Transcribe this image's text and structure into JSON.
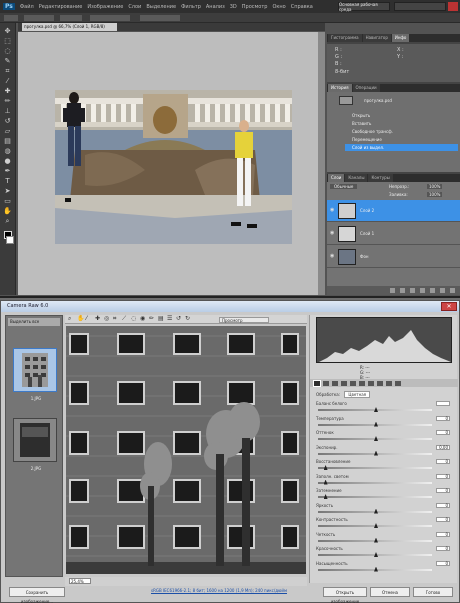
{
  "photoshop": {
    "logo": "Ps",
    "menu": [
      "Файл",
      "Редактирование",
      "Изображение",
      "Слои",
      "Выделение",
      "Фильтр",
      "Анализ",
      "3D",
      "Просмотр",
      "Окно",
      "Справка"
    ],
    "workspace": "Основная рабочая среда",
    "search_placeholder": "",
    "document_tab": "прогулка.psd @ 66,7% (Слой 1, RGB/8)",
    "tools": [
      "move-icon",
      "marquee-icon",
      "lasso-icon",
      "quick-select-icon",
      "crop-icon",
      "eyedropper-icon",
      "healing-icon",
      "brush-icon",
      "stamp-icon",
      "history-brush-icon",
      "eraser-icon",
      "gradient-icon",
      "blur-icon",
      "dodge-icon",
      "pen-icon",
      "type-icon",
      "path-select-icon",
      "shape-icon",
      "hand-icon",
      "zoom-icon"
    ],
    "info_panel": {
      "tabs": [
        "Гистограмма",
        "Навигатор",
        "Инфо"
      ],
      "rows": [
        "R :",
        "G :",
        "B :",
        "8-бит",
        "X :",
        "Y :"
      ]
    },
    "history_panel": {
      "tabs": [
        "История",
        "Операции"
      ],
      "document": "прогулка.psd",
      "states": [
        "Открыть",
        "Вставить",
        "Свободное трансф.",
        "Перемещение",
        "Слой из выдел."
      ]
    },
    "layers_panel": {
      "tabs": [
        "Слои",
        "Каналы",
        "Контуры"
      ],
      "blend_mode": "Обычные",
      "opacity_label": "Непрозр.:",
      "opacity": "100%",
      "fill_label": "Заливка:",
      "fill": "100%",
      "layers": [
        {
          "name": "Слой 2",
          "selected": true
        },
        {
          "name": "Слой 1",
          "selected": false
        },
        {
          "name": "Фон",
          "selected": false
        }
      ]
    },
    "colors": {
      "accent": "#3d91e6",
      "canvas_bg": "#bdbdbd",
      "panel_bg": "#535353"
    }
  },
  "camera_raw": {
    "title": "Camera Raw 6.0",
    "filmstrip_header": "Выделить все",
    "thumbnails": [
      {
        "caption": "1.JPG",
        "selected": true
      },
      {
        "caption": "2.JPG",
        "selected": false
      }
    ],
    "preview_label": "Просмотр",
    "zoom": "25,4%",
    "info_link": "sRGB IEC61966-2.1; 8 бит; 1600 на 1200 (1,9 Мп); 240 пикс/дюйм",
    "readout": [
      "R: ---",
      "G: ---",
      "B: ---"
    ],
    "treatment_label": "Обработка:",
    "treatment_value": "Цветная",
    "sliders": [
      {
        "label": "Баланс белого",
        "value": "",
        "pos": 0.5
      },
      {
        "label": "Температура",
        "value": "0",
        "pos": 0.5
      },
      {
        "label": "Оттенок",
        "value": "0",
        "pos": 0.5
      },
      {
        "label": "Экспонир.",
        "value": "0,00",
        "pos": 0.5
      },
      {
        "label": "Восстановление",
        "value": "0",
        "pos": 0.05
      },
      {
        "label": "Заполн. светом",
        "value": "0",
        "pos": 0.05
      },
      {
        "label": "Затемнение",
        "value": "0",
        "pos": 0.05
      },
      {
        "label": "Яркость",
        "value": "0",
        "pos": 0.5
      },
      {
        "label": "Контрастность",
        "value": "0",
        "pos": 0.5
      },
      {
        "label": "Четкость",
        "value": "0",
        "pos": 0.5
      },
      {
        "label": "Красочность",
        "value": "0",
        "pos": 0.5
      },
      {
        "label": "Насыщенность",
        "value": "0",
        "pos": 0.5
      }
    ],
    "buttons": {
      "save_as": "Сохранить изображение...",
      "open": "Открыть изображение",
      "cancel": "Отмена",
      "done": "Готово"
    }
  }
}
